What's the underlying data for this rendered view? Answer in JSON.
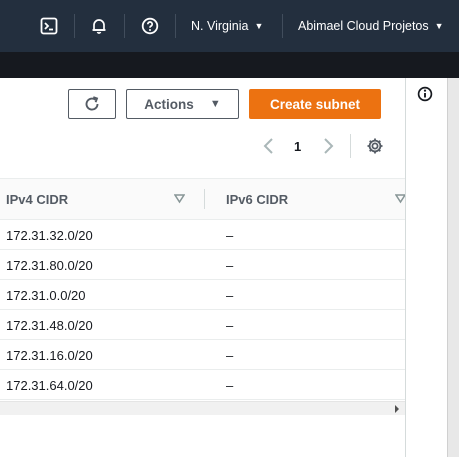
{
  "topnav": {
    "icons": [
      "cloudshell-icon",
      "bell-icon",
      "help-icon"
    ],
    "region": "N. Virginia",
    "account": "Abimael Cloud Projetos"
  },
  "toolbar": {
    "refresh_icon": "refresh-icon",
    "actions_label": "Actions",
    "create_label": "Create subnet"
  },
  "pagination": {
    "current_page": "1"
  },
  "table": {
    "columns": [
      "IPv4 CIDR",
      "IPv6 CIDR"
    ],
    "rows": [
      {
        "ipv4": "172.31.32.0/20",
        "ipv6": "–"
      },
      {
        "ipv4": "172.31.80.0/20",
        "ipv6": "–"
      },
      {
        "ipv4": "172.31.0.0/20",
        "ipv6": "–"
      },
      {
        "ipv4": "172.31.48.0/20",
        "ipv6": "–"
      },
      {
        "ipv4": "172.31.16.0/20",
        "ipv6": "–"
      },
      {
        "ipv4": "172.31.64.0/20",
        "ipv6": "–"
      }
    ]
  },
  "colors": {
    "nav_bg": "#232f3e",
    "primary": "#ec7211",
    "text": "#16191f",
    "muted": "#545b64"
  }
}
